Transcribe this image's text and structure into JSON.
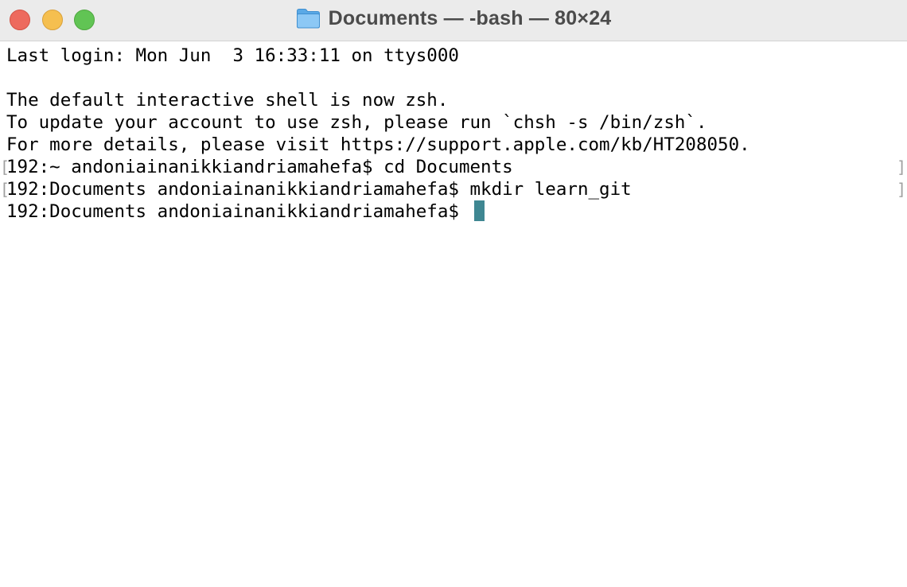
{
  "window": {
    "title": "Documents — -bash — 80×24",
    "folder_icon": "folder-icon",
    "traffic_lights": {
      "close": "#ed6a5e",
      "minimize": "#f5bf4f",
      "zoom": "#61c454"
    }
  },
  "terminal": {
    "lines": [
      "Last login: Mon Jun  3 16:33:11 on ttys000",
      "",
      "The default interactive shell is now zsh.",
      "To update your account to use zsh, please run `chsh -s /bin/zsh`.",
      "For more details, please visit https://support.apple.com/kb/HT208050.",
      "192:~ andoniainanikkiandriamahefa$ cd Documents",
      "192:Documents andoniainanikkiandriamahefa$ mkdir learn_git",
      "192:Documents andoniainanikkiandriamahefa$ "
    ],
    "cursor_color": "#3f8792"
  }
}
